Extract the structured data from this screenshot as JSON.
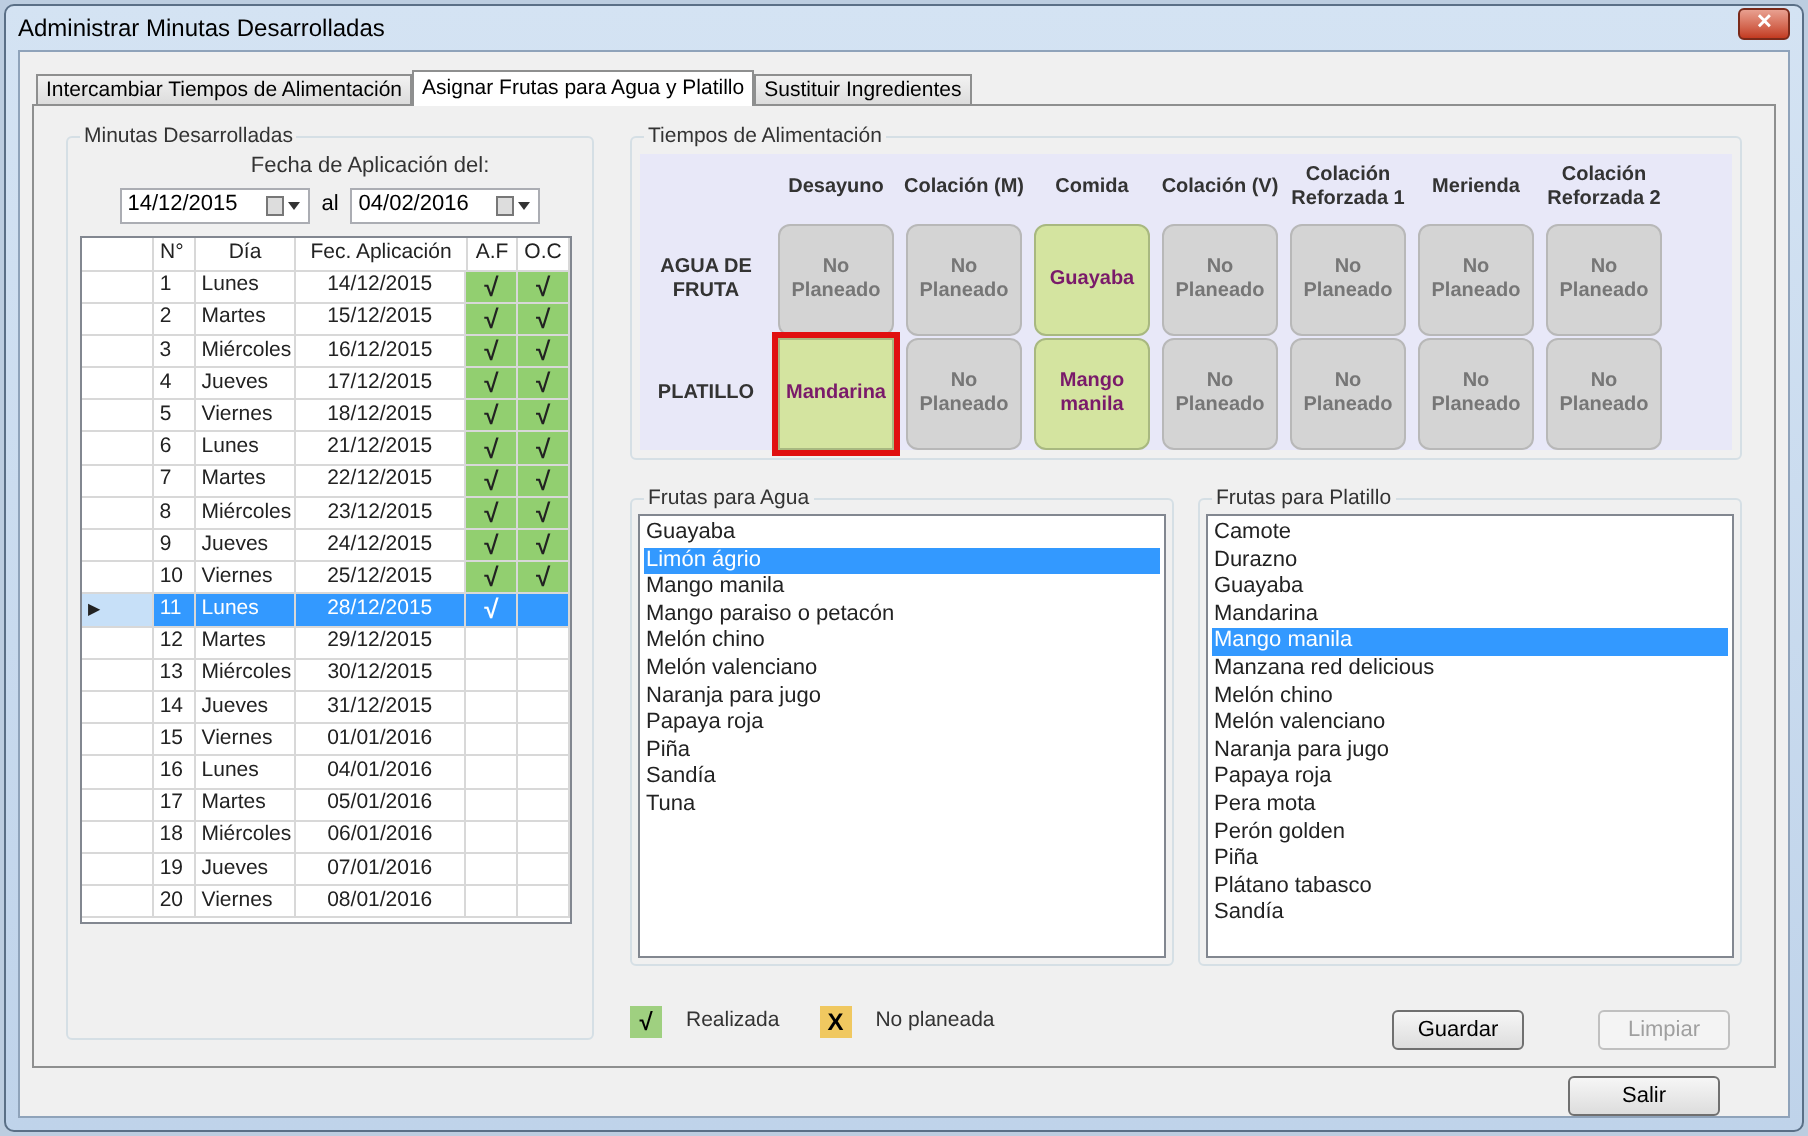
{
  "window": {
    "title": "Administrar Minutas Desarrolladas",
    "close": "✕"
  },
  "tabs": [
    {
      "label": "Intercambiar Tiempos de Alimentación",
      "selected": false
    },
    {
      "label": "Asignar Frutas para Agua y Platillo",
      "selected": true
    },
    {
      "label": "Sustituir Ingredientes",
      "selected": false
    }
  ],
  "minutas": {
    "title": "Minutas Desarrolladas",
    "date_label": "Fecha de Aplicación del:",
    "from": "14/12/2015",
    "to_label": "al",
    "to": "04/02/2016",
    "columns": [
      "N°",
      "Día",
      "Fec. Aplicación",
      "A.F",
      "O.C"
    ],
    "check": "√",
    "row_marker": "▶",
    "rows": [
      {
        "n": "1",
        "day": "Lunes",
        "date": "14/12/2015",
        "af": true,
        "oc": true,
        "selected": false
      },
      {
        "n": "2",
        "day": "Martes",
        "date": "15/12/2015",
        "af": true,
        "oc": true,
        "selected": false
      },
      {
        "n": "3",
        "day": "Miércoles",
        "date": "16/12/2015",
        "af": true,
        "oc": true,
        "selected": false
      },
      {
        "n": "4",
        "day": "Jueves",
        "date": "17/12/2015",
        "af": true,
        "oc": true,
        "selected": false
      },
      {
        "n": "5",
        "day": "Viernes",
        "date": "18/12/2015",
        "af": true,
        "oc": true,
        "selected": false
      },
      {
        "n": "6",
        "day": "Lunes",
        "date": "21/12/2015",
        "af": true,
        "oc": true,
        "selected": false
      },
      {
        "n": "7",
        "day": "Martes",
        "date": "22/12/2015",
        "af": true,
        "oc": true,
        "selected": false
      },
      {
        "n": "8",
        "day": "Miércoles",
        "date": "23/12/2015",
        "af": true,
        "oc": true,
        "selected": false
      },
      {
        "n": "9",
        "day": "Jueves",
        "date": "24/12/2015",
        "af": true,
        "oc": true,
        "selected": false
      },
      {
        "n": "10",
        "day": "Viernes",
        "date": "25/12/2015",
        "af": true,
        "oc": true,
        "selected": false
      },
      {
        "n": "11",
        "day": "Lunes",
        "date": "28/12/2015",
        "af": true,
        "oc": false,
        "selected": true
      },
      {
        "n": "12",
        "day": "Martes",
        "date": "29/12/2015",
        "af": false,
        "oc": false,
        "selected": false
      },
      {
        "n": "13",
        "day": "Miércoles",
        "date": "30/12/2015",
        "af": false,
        "oc": false,
        "selected": false
      },
      {
        "n": "14",
        "day": "Jueves",
        "date": "31/12/2015",
        "af": false,
        "oc": false,
        "selected": false
      },
      {
        "n": "15",
        "day": "Viernes",
        "date": "01/01/2016",
        "af": false,
        "oc": false,
        "selected": false
      },
      {
        "n": "16",
        "day": "Lunes",
        "date": "04/01/2016",
        "af": false,
        "oc": false,
        "selected": false
      },
      {
        "n": "17",
        "day": "Martes",
        "date": "05/01/2016",
        "af": false,
        "oc": false,
        "selected": false
      },
      {
        "n": "18",
        "day": "Miércoles",
        "date": "06/01/2016",
        "af": false,
        "oc": false,
        "selected": false
      },
      {
        "n": "19",
        "day": "Jueves",
        "date": "07/01/2016",
        "af": false,
        "oc": false,
        "selected": false
      },
      {
        "n": "20",
        "day": "Viernes",
        "date": "08/01/2016",
        "af": false,
        "oc": false,
        "selected": false
      }
    ]
  },
  "tiempos": {
    "title": "Tiempos de Alimentación",
    "columns": [
      "Desayuno",
      "Colación (M)",
      "Comida",
      "Colación (V)",
      "Colación Reforzada 1",
      "Merienda",
      "Colación Reforzada 2"
    ],
    "rows": [
      {
        "label": "AGUA DE FRUTA",
        "tiles": [
          {
            "text": "No Planeado",
            "planned": false,
            "selected": false
          },
          {
            "text": "No Planeado",
            "planned": false,
            "selected": false
          },
          {
            "text": "Guayaba",
            "planned": true,
            "selected": false
          },
          {
            "text": "No Planeado",
            "planned": false,
            "selected": false
          },
          {
            "text": "No Planeado",
            "planned": false,
            "selected": false
          },
          {
            "text": "No Planeado",
            "planned": false,
            "selected": false
          },
          {
            "text": "No Planeado",
            "planned": false,
            "selected": false
          }
        ]
      },
      {
        "label": "PLATILLO",
        "tiles": [
          {
            "text": "Mandarina",
            "planned": true,
            "selected": true
          },
          {
            "text": "No Planeado",
            "planned": false,
            "selected": false
          },
          {
            "text": "Mango manila",
            "planned": true,
            "selected": false
          },
          {
            "text": "No Planeado",
            "planned": false,
            "selected": false
          },
          {
            "text": "No Planeado",
            "planned": false,
            "selected": false
          },
          {
            "text": "No Planeado",
            "planned": false,
            "selected": false
          },
          {
            "text": "No Planeado",
            "planned": false,
            "selected": false
          }
        ]
      }
    ]
  },
  "lists": [
    {
      "title": "Frutas para Agua",
      "items": [
        {
          "label": "Guayaba",
          "selected": false
        },
        {
          "label": "Limón ágrio",
          "selected": true
        },
        {
          "label": "Mango manila",
          "selected": false
        },
        {
          "label": "Mango paraiso o petacón",
          "selected": false
        },
        {
          "label": "Melón chino",
          "selected": false
        },
        {
          "label": "Melón valenciano",
          "selected": false
        },
        {
          "label": "Naranja para jugo",
          "selected": false
        },
        {
          "label": "Papaya roja",
          "selected": false
        },
        {
          "label": "Piña",
          "selected": false
        },
        {
          "label": "Sandía",
          "selected": false
        },
        {
          "label": "Tuna",
          "selected": false
        }
      ]
    },
    {
      "title": "Frutas para Platillo",
      "items": [
        {
          "label": "Camote",
          "selected": false
        },
        {
          "label": "Durazno",
          "selected": false
        },
        {
          "label": "Guayaba",
          "selected": false
        },
        {
          "label": "Mandarina",
          "selected": false
        },
        {
          "label": "Mango manila",
          "selected": true
        },
        {
          "label": "Manzana red delicious",
          "selected": false
        },
        {
          "label": "Melón chino",
          "selected": false
        },
        {
          "label": "Melón valenciano",
          "selected": false
        },
        {
          "label": "Naranja para jugo",
          "selected": false
        },
        {
          "label": "Papaya roja",
          "selected": false
        },
        {
          "label": "Pera mota",
          "selected": false
        },
        {
          "label": "Perón golden",
          "selected": false
        },
        {
          "label": "Piña",
          "selected": false
        },
        {
          "label": "Plátano tabasco",
          "selected": false
        },
        {
          "label": "Sandía",
          "selected": false
        }
      ]
    }
  ],
  "legend": [
    {
      "symbol": "√",
      "label": "Realizada",
      "color": "#9fd080"
    },
    {
      "symbol": "X",
      "label": "No planeada",
      "color": "#f0c860"
    }
  ],
  "buttons": [
    {
      "label": "Guardar",
      "disabled": false
    },
    {
      "label": "Limpiar",
      "disabled": true
    }
  ],
  "exit_button": {
    "label": "Salir"
  }
}
